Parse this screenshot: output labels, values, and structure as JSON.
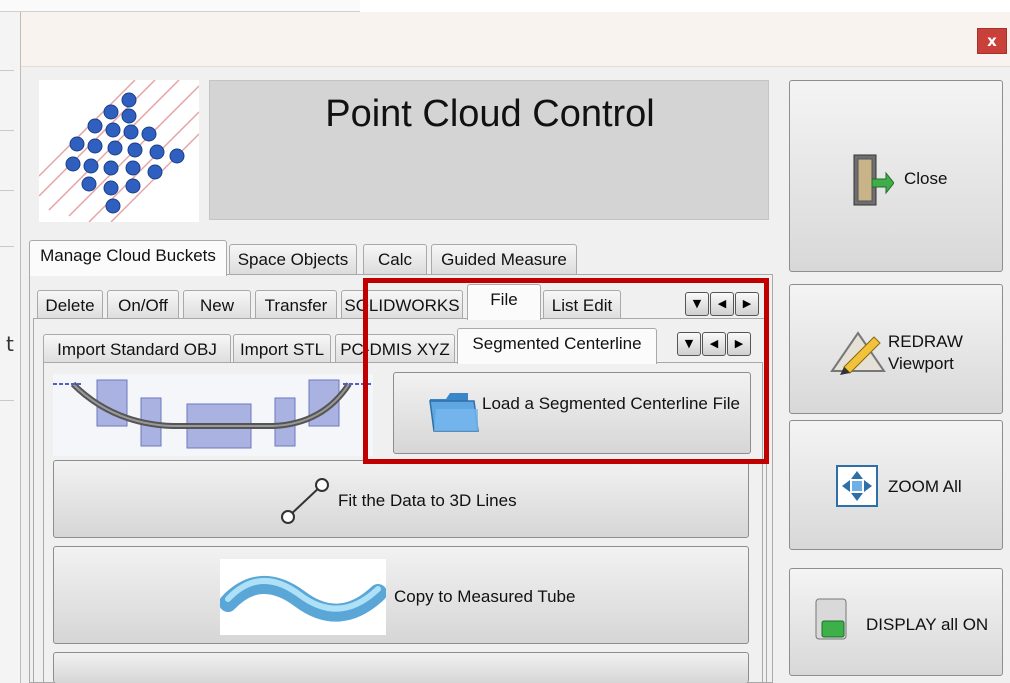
{
  "window": {
    "close_glyph": "x"
  },
  "header": {
    "title": "Point Cloud Control"
  },
  "main_tabs": [
    "Manage Cloud Buckets",
    "Space Objects",
    "Calc",
    "Guided Measure"
  ],
  "sub_tabs": [
    "Delete",
    "On/Off",
    "New",
    "Transfer",
    "SOLIDWORKS",
    "File",
    "List Edit"
  ],
  "file_tabs": [
    "Import Standard OBJ",
    "Import STL",
    "PC-DMIS XYZ",
    "Segmented Centerline"
  ],
  "active": {
    "main_tab": "Manage Cloud Buckets",
    "sub_tab": "File",
    "file_tab": "Segmented Centerline"
  },
  "buttons": {
    "load_segmented": "Load a Segmented Centerline File",
    "fit_lines": "Fit the Data to 3D Lines",
    "copy_tube": "Copy to Measured Tube"
  },
  "side_buttons": {
    "close": "Close",
    "redraw_line1": "REDRAW",
    "redraw_line2": "Viewport",
    "zoom_all": "ZOOM All",
    "display_all_on": "DISPLAY all ON"
  },
  "icons": {
    "logo": "point-cloud-logo-icon",
    "folder": "folder-icon",
    "line_fit": "line-fit-icon",
    "tube": "tube-icon",
    "door": "exit-door-icon",
    "redraw": "pencil-ruler-icon",
    "zoom": "zoom-all-icon",
    "display": "display-toggle-icon",
    "spin_down": "▼",
    "spin_left": "◀",
    "spin_right": "▶"
  },
  "colors": {
    "highlight": "#c00000",
    "close_button": "#c9403a",
    "sphere": "#2f5fbf"
  }
}
